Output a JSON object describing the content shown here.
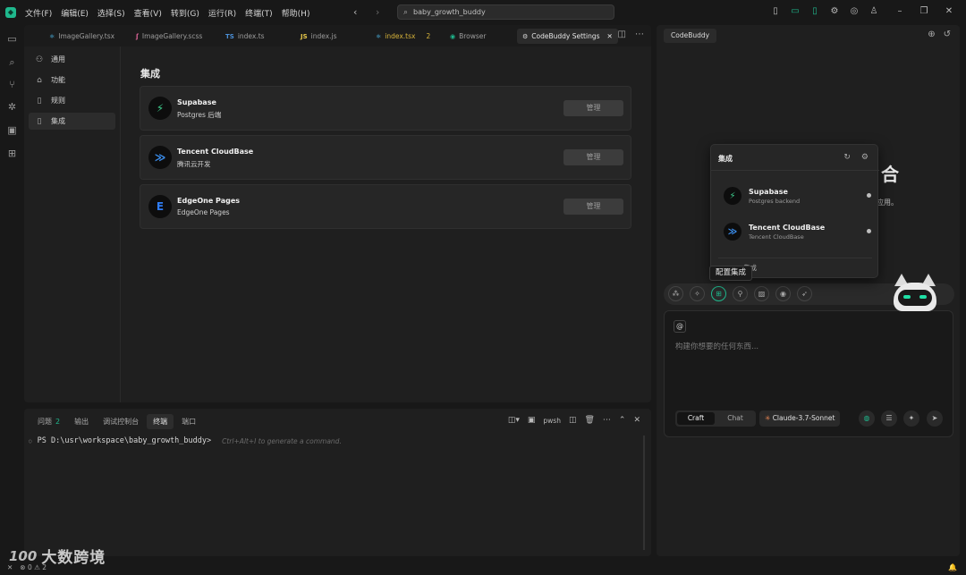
{
  "titlebar": {
    "menu": [
      "文件(F)",
      "编辑(E)",
      "选择(S)",
      "查看(V)",
      "转到(G)",
      "运行(R)",
      "终端(T)",
      "帮助(H)"
    ],
    "search_text": "baby_growth_buddy"
  },
  "editor": {
    "tabs": [
      {
        "icon": "⚛",
        "label": "ImageGallery.tsx",
        "color": "#4fc3f7"
      },
      {
        "icon": "ʃ",
        "label": "ImageGallery.scss",
        "color": "#e0669a"
      },
      {
        "icon": "TS",
        "label": "index.ts",
        "color": "#4b8fd6"
      },
      {
        "icon": "JS",
        "label": "index.js",
        "color": "#e8c94a"
      },
      {
        "icon": "⚛",
        "label": "index.tsx",
        "color": "#4fc3f7",
        "modified": "2"
      },
      {
        "icon": "◉",
        "label": "Browser",
        "color": "#1fb88d"
      },
      {
        "icon": "⚙",
        "label": "CodeBuddy Settings",
        "close": "✕"
      }
    ],
    "nav": [
      {
        "icon": "⚇",
        "label": "通用"
      },
      {
        "icon": "⌂",
        "label": "功能"
      },
      {
        "icon": "▯",
        "label": "规则"
      },
      {
        "icon": "▯",
        "label": "集成"
      }
    ],
    "settings_title": "集成",
    "integrations": [
      {
        "name": "Supabase",
        "desc": "Postgres 后端",
        "button": "管理",
        "logo": "⚡",
        "logo_color": "#3ecf8e"
      },
      {
        "name": "Tencent CloudBase",
        "desc": "腾讯云开发",
        "button": "管理",
        "logo": "≫",
        "logo_color": "#3b8ff0"
      },
      {
        "name": "EdgeOne Pages",
        "desc": "EdgeOne Pages",
        "button": "管理",
        "logo": "E",
        "logo_color": "#2f7df6"
      }
    ]
  },
  "panel": {
    "tabs": [
      {
        "label": "问题",
        "badge": "2"
      },
      {
        "label": "输出"
      },
      {
        "label": "调试控制台"
      },
      {
        "label": "终端"
      },
      {
        "label": "端口"
      }
    ],
    "shell_label": "pwsh",
    "prompt": "PS D:\\usr\\workspace\\baby_growth_buddy>",
    "hint": "Ctrl+Alt+I to generate a command."
  },
  "chat": {
    "tab_label": "CodeBuddy",
    "bg_heading": "合",
    "bg_sub": "应用。",
    "popup": {
      "title": "集成",
      "items": [
        {
          "name": "Supabase",
          "desc": "Postgres backend",
          "logo": "⚡",
          "logo_color": "#3ecf8e"
        },
        {
          "name": "Tencent CloudBase",
          "desc": "Tencent CloudBase",
          "logo": "≫",
          "logo_color": "#3b8ff0"
        }
      ],
      "footer": "集成"
    },
    "tooltip": "配置集成",
    "composer": {
      "at": "@",
      "placeholder": "构建你想要的任何东西...",
      "modes": [
        "Craft",
        "Chat"
      ],
      "model": "Claude-3.7-Sonnet"
    }
  },
  "statusbar": {
    "errors": "0",
    "warnings": "2"
  },
  "watermark": {
    "text": "大数跨境",
    "mark": "100"
  }
}
